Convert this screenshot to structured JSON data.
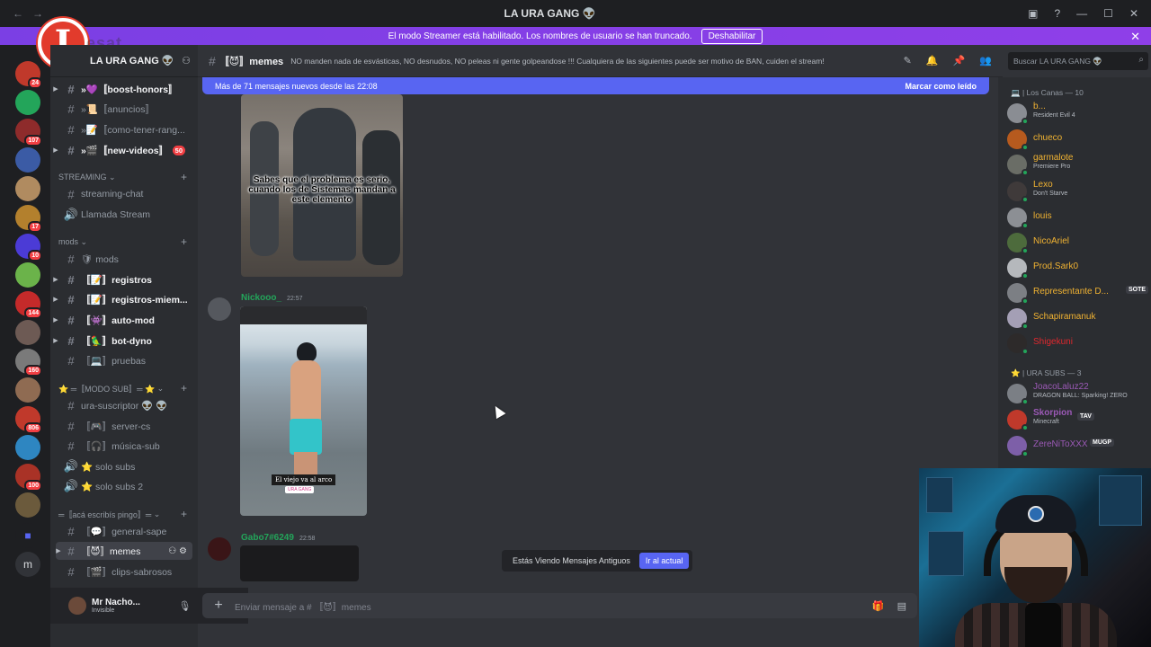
{
  "window": {
    "title": "LA URA GANG 👽",
    "back": "←",
    "forward": "→"
  },
  "banner": {
    "text": "El modo Streamer está habilitado. Los nombres de usuario se han truncado.",
    "button": "Deshabilitar"
  },
  "logo": {
    "letter": "I",
    "tag": "esat"
  },
  "server": {
    "name": "LA URA GANG 👽"
  },
  "server_badges": [
    "24",
    "107",
    "17",
    "10",
    "144",
    "160",
    "806",
    "100"
  ],
  "channels": [
    {
      "label": "»💜〚boost-honors〛",
      "bold": true
    },
    {
      "label": "»📜〚anuncios〛",
      "bold": false
    },
    {
      "label": "»📝〚como-tener-rang...",
      "bold": false
    },
    {
      "label": "»🎬〚new-videos〛",
      "bold": true,
      "badge": "50"
    },
    {
      "label": "STREAMING",
      "cat": true
    },
    {
      "label": "streaming-chat",
      "bold": false
    },
    {
      "label": "Llamada Stream",
      "voice": true
    },
    {
      "label": "mods",
      "cat": true
    },
    {
      "label": "🛡 mods",
      "bold": false
    },
    {
      "label": "〚📝〛registros",
      "bold": true
    },
    {
      "label": "〚📝〛registros-miem...",
      "bold": true
    },
    {
      "label": "〚👾〛auto-mod",
      "bold": true
    },
    {
      "label": "〚🦜〛bot-dyno",
      "bold": true
    },
    {
      "label": "〚💻〛pruebas",
      "bold": false
    },
    {
      "label": "⭐ ═〚MODO SUB〛═ ⭐",
      "cat": true
    },
    {
      "label": "ura-suscriptor 👽 👽",
      "bold": false
    },
    {
      "label": "〚🎮〛server-cs",
      "bold": false
    },
    {
      "label": "〚🎧〛música-sub",
      "bold": false
    },
    {
      "label": "⭐ solo subs",
      "voice": true
    },
    {
      "label": "⭐ solo subs 2",
      "voice": true
    },
    {
      "label": "═〚acá escribís pingo〛═",
      "cat": true
    },
    {
      "label": "〚💬〛general-sape",
      "bold": false
    },
    {
      "label": "〚😈〛memes",
      "selected": true
    },
    {
      "label": "〚🎬〛clips-sabrosos",
      "bold": false
    }
  ],
  "user": {
    "name": "Mr Nacho...",
    "status": "Invisible"
  },
  "channel": {
    "name": "〚😈〛memes",
    "topic": "NO manden nada de esvásticas, NO desnudos, NO peleas ni gente golpeandose !!! Cualquiera de las siguientes puede ser motivo de BAN, cuiden el stream!"
  },
  "search": {
    "placeholder": "Buscar LA URA GANG 👽"
  },
  "newbar": {
    "text": "Más de 71 mensajes nuevos desde las 22:08",
    "mark": "Marcar como leído"
  },
  "messages": [
    {
      "caption": "Sabes que el problema es serio, cuando los de Sistemas mandan a este elemento"
    },
    {
      "author": "Nickooo_",
      "time": "22:57",
      "caption": "El viejo va al arco",
      "tag": "URA GANG"
    },
    {
      "author": "Gabo7#6249",
      "time": "22:58"
    }
  ],
  "floating": {
    "text": "Estás Viendo Mensajes Antiguos",
    "button": "Ir al actual"
  },
  "composer": {
    "placeholder": "Enviar mensaje a # 〚😈〛memes"
  },
  "members": {
    "cat1": "💻 | Los Canas — 10",
    "group1": [
      {
        "name": "b...",
        "status": "Resident Evil 4",
        "color": "#f0b232"
      },
      {
        "name": "chueco",
        "color": "#f0b232"
      },
      {
        "name": "garmalote",
        "status": "Premiere Pro",
        "color": "#f0b232"
      },
      {
        "name": "Lexo",
        "status": "Don't Starve",
        "color": "#f0b232"
      },
      {
        "name": "louis",
        "color": "#f0b232"
      },
      {
        "name": "NicoAriel",
        "color": "#f0b232"
      },
      {
        "name": "Prod.Sark0",
        "color": "#f0b232"
      },
      {
        "name": "Representante D...",
        "tag": "SOTE",
        "color": "#f0b232"
      },
      {
        "name": "Schapiramanuk",
        "color": "#f0b232"
      },
      {
        "name": "Shigekuni",
        "color": "#e0282e"
      }
    ],
    "cat2": "⭐ | URA SUBS — 3",
    "group2": [
      {
        "name": "JoacoLaluz22",
        "status": "DRAGON BALL: Sparking! ZERO",
        "color": "#9b59b6"
      },
      {
        "name": "Skorpion",
        "status": "Minecraft",
        "tag": "TAV",
        "color": "#9b59b6"
      },
      {
        "name": "ZereNiToXXX",
        "tag": "MUGP",
        "color": "#9b59b6"
      }
    ]
  }
}
